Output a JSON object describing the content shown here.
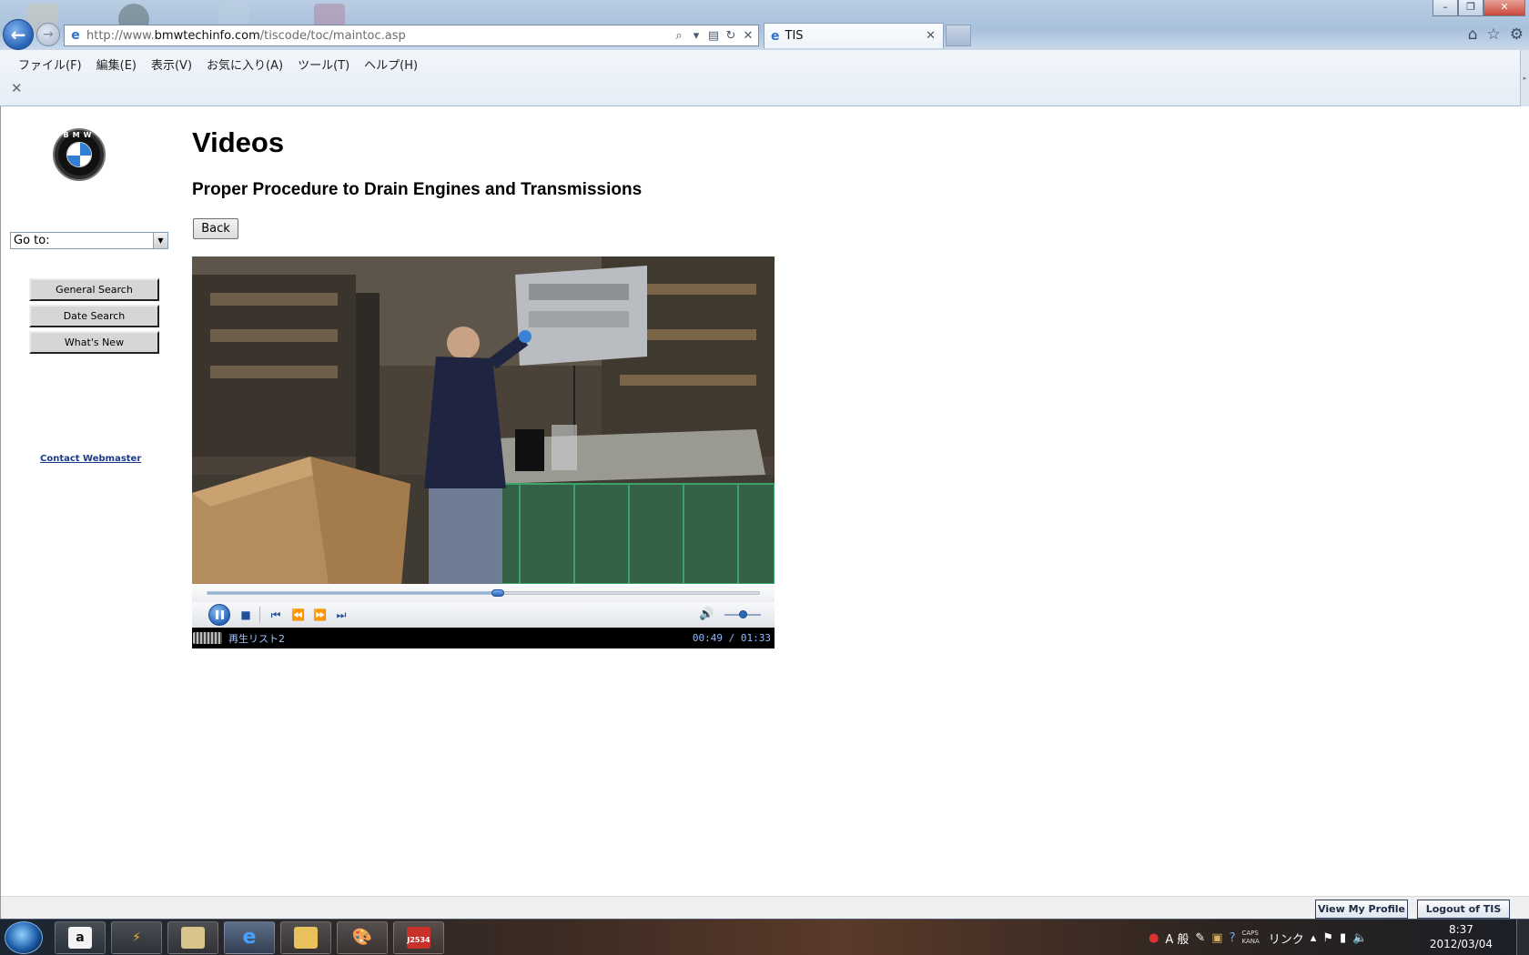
{
  "browser": {
    "address_prefix": "http://www.",
    "address_domain": "bmwtechinfo.com",
    "address_path": "/tiscode/toc/maintoc.asp",
    "tab_title": "TIS",
    "menu": [
      "ファイル(F)",
      "編集(E)",
      "表示(V)",
      "お気に入り(A)",
      "ツール(T)",
      "ヘルプ(H)"
    ]
  },
  "sidebar": {
    "logo_text": "BMW",
    "goto_value": "Go to:",
    "buttons": [
      "General Search",
      "Date Search",
      "What's New"
    ],
    "contact_link": "Contact Webmaster"
  },
  "main": {
    "page_title": "Videos",
    "video_title": "Proper Procedure to Drain Engines and Transmissions",
    "back_label": "Back"
  },
  "player": {
    "playlist": "再生リスト2",
    "time_current": "00:49",
    "time_total": "01:33",
    "time_separator": " / ",
    "progress_fraction": 0.527,
    "volume_fraction": 0.5,
    "state": "playing"
  },
  "footer": {
    "profile_label": "View My Profile",
    "logout_label": "Logout of TIS"
  },
  "taskbar": {
    "tray_link": "リンク",
    "caps": "CAPS",
    "kana": "KANA",
    "ime": "A 般",
    "clock_time": "8:37",
    "clock_date": "2012/03/04",
    "j2534_label": "J2534"
  },
  "colors": {
    "accent": "#2c68b8",
    "link": "#1a3a8a",
    "status_text": "#8fb9ff"
  },
  "icons": [
    "back-arrow-icon",
    "forward-arrow-icon",
    "ie-icon",
    "search-icon",
    "compat-view-icon",
    "refresh-icon",
    "stop-icon",
    "home-icon",
    "favorites-star-icon",
    "gear-icon",
    "pause-icon",
    "stop-media-icon",
    "previous-icon",
    "rewind-icon",
    "fast-forward-icon",
    "next-icon",
    "volume-icon",
    "windows-start-icon"
  ]
}
